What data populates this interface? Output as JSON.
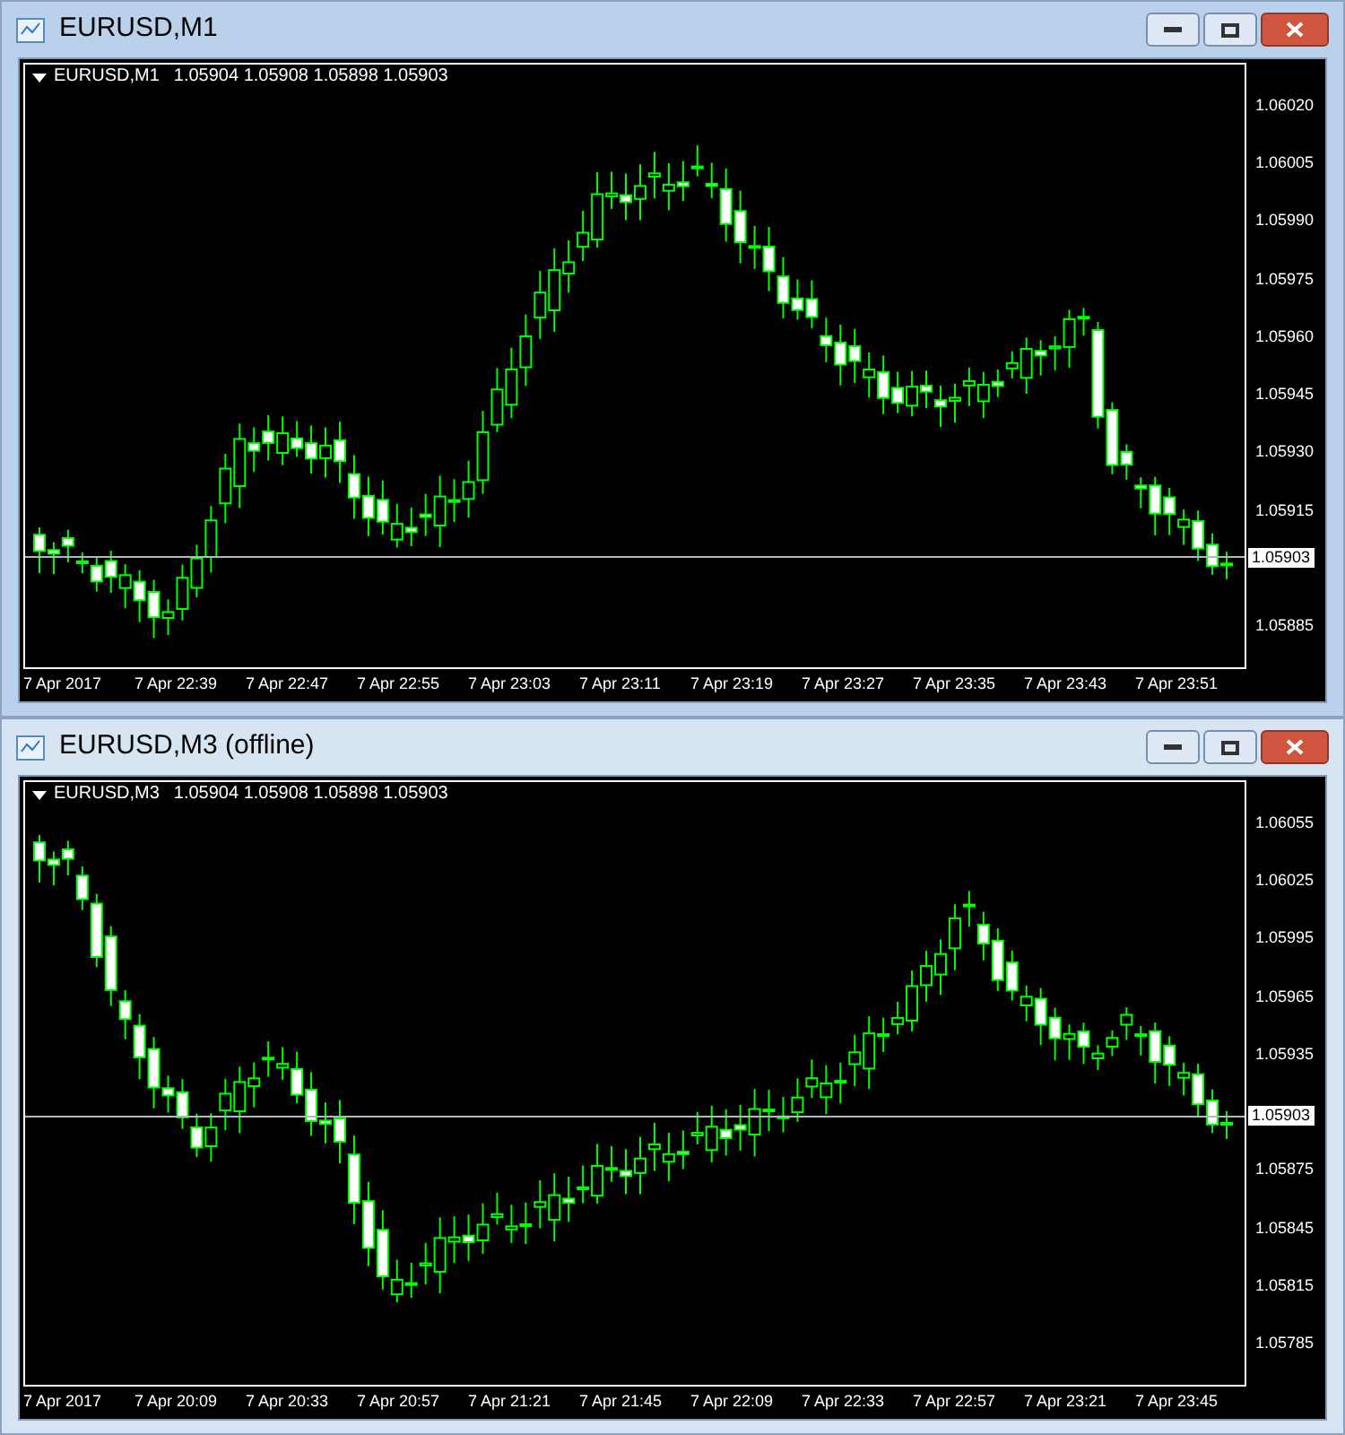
{
  "windows": [
    {
      "title": "EURUSD,M1",
      "symbol": "EURUSD,M1",
      "ohlc": "1.05904 1.05908 1.05898 1.05903",
      "current_price": "1.05903",
      "active": true,
      "price_labels": [
        "1.06020",
        "1.06005",
        "1.05990",
        "1.05975",
        "1.05960",
        "1.05945",
        "1.05930",
        "1.05915",
        "1.05885"
      ],
      "time_labels": [
        "7 Apr 2017",
        "7 Apr 22:39",
        "7 Apr 22:47",
        "7 Apr 22:55",
        "7 Apr 23:03",
        "7 Apr 23:11",
        "7 Apr 23:19",
        "7 Apr 23:27",
        "7 Apr 23:35",
        "7 Apr 23:43",
        "7 Apr 23:51"
      ]
    },
    {
      "title": "EURUSD,M3 (offline)",
      "symbol": "EURUSD,M3",
      "ohlc": "1.05904 1.05908 1.05898 1.05903",
      "current_price": "1.05903",
      "active": false,
      "price_labels": [
        "1.06055",
        "1.06025",
        "1.05995",
        "1.05965",
        "1.05935",
        "1.05875",
        "1.05845",
        "1.05815",
        "1.05785"
      ],
      "time_labels": [
        "7 Apr 2017",
        "7 Apr 20:09",
        "7 Apr 20:33",
        "7 Apr 20:57",
        "7 Apr 21:21",
        "7 Apr 21:45",
        "7 Apr 22:09",
        "7 Apr 22:33",
        "7 Apr 22:57",
        "7 Apr 23:21",
        "7 Apr 23:45"
      ]
    }
  ]
}
